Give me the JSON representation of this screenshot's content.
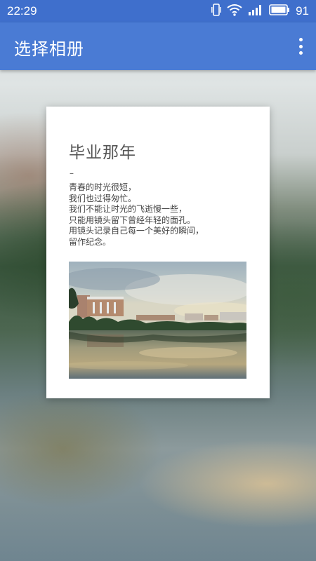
{
  "status_bar": {
    "time": "22:29",
    "battery_level": "91",
    "icons": [
      "vibrate-icon",
      "wifi-icon",
      "signal-icon",
      "battery-icon"
    ]
  },
  "app_bar": {
    "title": "选择相册",
    "menu_icon": "more-vert-icon"
  },
  "album_card": {
    "title": "毕业那年",
    "dash": "–",
    "poem_lines": [
      "青春的时光很短，",
      "我们也过得匆忙。",
      "我们不能让时光的飞逝慢一些，",
      "只能用镜头留下曾经年轻的面孔。",
      "用镜头记录自己每一个美好的瞬间，",
      "留作纪念。"
    ]
  },
  "colors": {
    "status_bar": "#3f6fcc",
    "app_bar": "#4a7bd4",
    "card": "#ffffff",
    "title_text": "#555555"
  }
}
